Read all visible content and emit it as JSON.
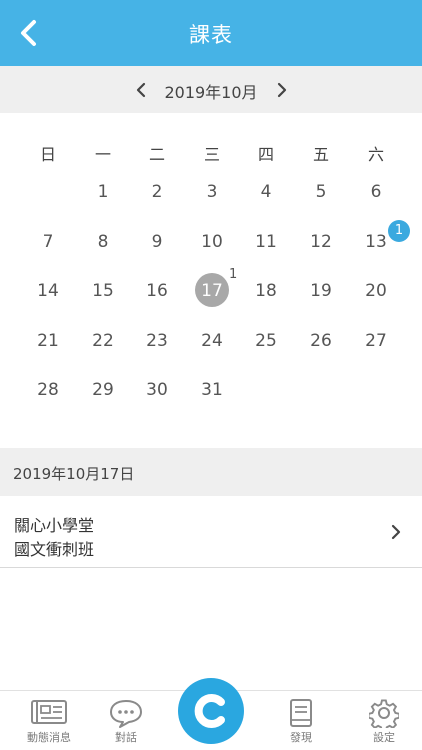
{
  "header": {
    "title": "課表"
  },
  "month_bar": {
    "label": "2019年10月"
  },
  "calendar": {
    "weekdays": [
      "日",
      "一",
      "二",
      "三",
      "四",
      "五",
      "六"
    ],
    "days": [
      "1",
      "2",
      "3",
      "4",
      "5",
      "6",
      "7",
      "8",
      "9",
      "10",
      "11",
      "12",
      "13",
      "14",
      "15",
      "16",
      "17",
      "18",
      "19",
      "20",
      "21",
      "22",
      "23",
      "24",
      "25",
      "26",
      "27",
      "28",
      "29",
      "30",
      "31"
    ],
    "today_badge": "1",
    "day13_badge": "1"
  },
  "selected_date": {
    "label": "2019年10月17日"
  },
  "course": {
    "school": "關心小學堂",
    "class_name": "國文衝刺班"
  },
  "tabbar": {
    "news": "動態消息",
    "chat": "對話",
    "discover": "發現",
    "settings": "設定"
  },
  "colors": {
    "accent": "#46b3e6",
    "badge": "#3aa9df",
    "today": "#a8a8a8"
  }
}
